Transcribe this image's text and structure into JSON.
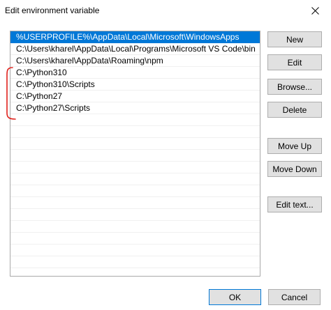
{
  "window": {
    "title": "Edit environment variable",
    "close_icon": "close-icon"
  },
  "entries": [
    {
      "text": "%USERPROFILE%\\AppData\\Local\\Microsoft\\WindowsApps",
      "selected": true
    },
    {
      "text": "C:\\Users\\kharel\\AppData\\Local\\Programs\\Microsoft VS Code\\bin",
      "selected": false
    },
    {
      "text": "C:\\Users\\kharel\\AppData\\Roaming\\npm",
      "selected": false
    },
    {
      "text": "C:\\Python310",
      "selected": false
    },
    {
      "text": "C:\\Python310\\Scripts",
      "selected": false
    },
    {
      "text": "C:\\Python27",
      "selected": false
    },
    {
      "text": "C:\\Python27\\Scripts",
      "selected": false
    }
  ],
  "buttons": {
    "new": "New",
    "edit": "Edit",
    "browse": "Browse...",
    "delete": "Delete",
    "move_up": "Move Up",
    "move_down": "Move Down",
    "edit_text": "Edit text...",
    "ok": "OK",
    "cancel": "Cancel"
  },
  "colors": {
    "selection": "#0078d7",
    "annotation": "#e0201b"
  }
}
